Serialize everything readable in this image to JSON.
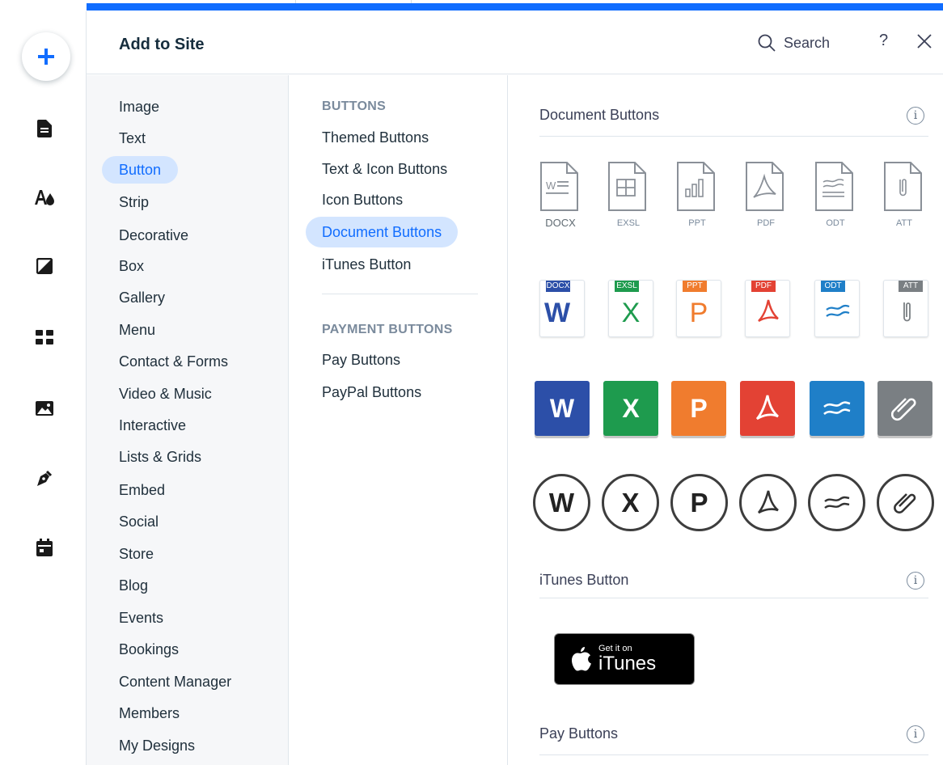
{
  "panel": {
    "title": "Add to Site",
    "search_label": "Search",
    "help_label": "?"
  },
  "categories": [
    "Image",
    "Text",
    "Button",
    "Strip",
    "Decorative",
    "Box",
    "Gallery",
    "Menu",
    "Contact & Forms",
    "Video & Music",
    "Interactive",
    "Lists & Grids",
    "Embed",
    "Social",
    "Store",
    "Blog",
    "Events",
    "Bookings",
    "Content Manager",
    "Members",
    "My Designs"
  ],
  "active_category": "Button",
  "subcategories": {
    "buttons_heading": "BUTTONS",
    "buttons": [
      "Themed Buttons",
      "Text & Icon Buttons",
      "Icon Buttons",
      "Document Buttons",
      "iTunes Button"
    ],
    "payment_heading": "PAYMENT BUTTONS",
    "payment": [
      "Pay Buttons",
      "PayPal Buttons"
    ],
    "active": "Document Buttons"
  },
  "sections": {
    "document_buttons": "Document Buttons",
    "itunes_button": "iTunes Button",
    "pay_buttons": "Pay Buttons"
  },
  "info_glyph": "i",
  "doc_outline_labels": [
    "DOCX",
    "EXSL",
    "PPT",
    "PDF",
    "ODT",
    "ATT"
  ],
  "doc_card_tabs": [
    "DOCX",
    "EXSL",
    "PPT",
    "PDF",
    "ODT",
    "ATT"
  ],
  "doc_letters": [
    "W",
    "X",
    "P"
  ],
  "itunes": {
    "line1": "Get it on",
    "line2": "iTunes"
  },
  "colors": {
    "accent": "#116dff",
    "word": "#2c4fa8",
    "excel": "#1e9b4e",
    "ppt": "#f07c2e",
    "pdf": "#e34234",
    "odt": "#1f7fc8",
    "att": "#7a7f83"
  },
  "rail_icons": [
    "plus-icon",
    "page-icon",
    "theme-icon",
    "background-icon",
    "apps-icon",
    "media-icon",
    "pen-icon",
    "calendar-icon"
  ]
}
